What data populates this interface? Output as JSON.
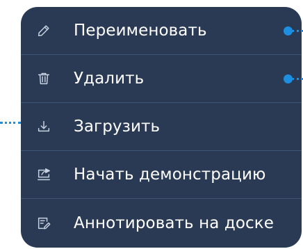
{
  "menu": {
    "items": [
      {
        "label": "Переименовать",
        "icon": "pencil-icon"
      },
      {
        "label": "Удалить",
        "icon": "trash-icon"
      },
      {
        "label": "Загрузить",
        "icon": "download-icon"
      },
      {
        "label": "Начать демонстрацию",
        "icon": "screen-share-icon"
      },
      {
        "label": "Аннотировать на доске",
        "icon": "whiteboard-annotate-icon"
      }
    ]
  },
  "colors": {
    "menu_background": "#2a3a55",
    "divider": "#3f5575",
    "text": "#ffffff",
    "icon": "#c8d2e0",
    "annotation_accent": "#1d8fe0"
  }
}
